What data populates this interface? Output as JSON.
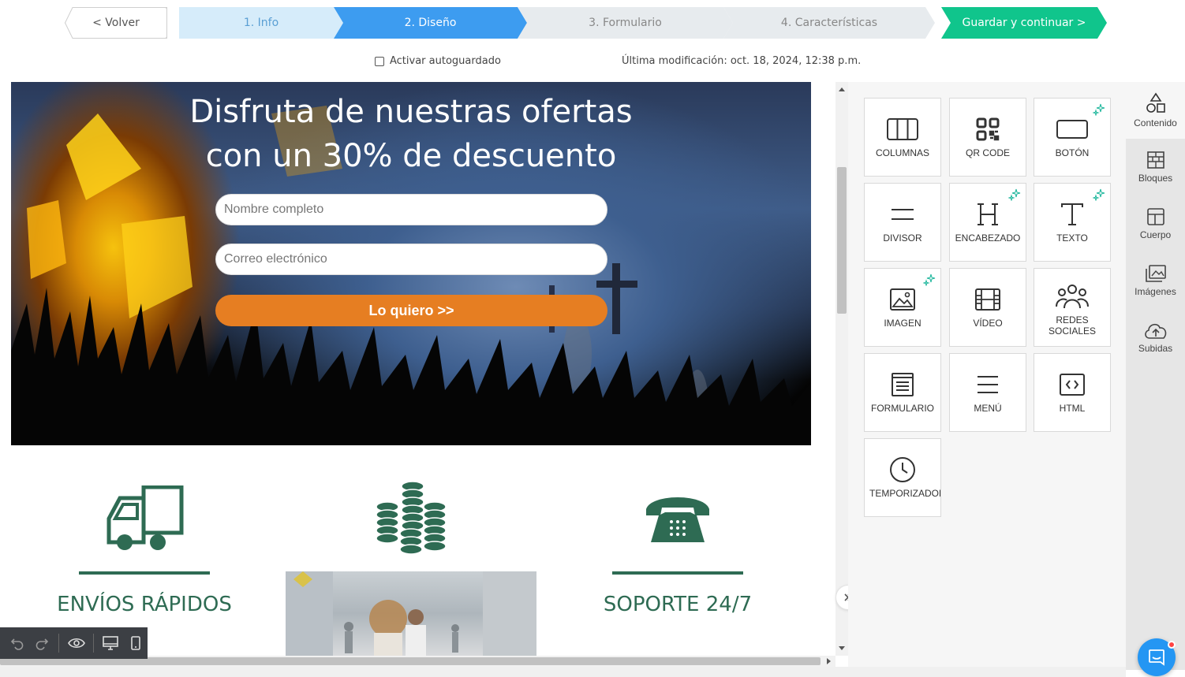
{
  "steps": {
    "back": "< Volver",
    "info": "1. Info",
    "design": "2. Diseño",
    "form": "3. Formulario",
    "features": "4. Características",
    "save": "Guardar y continuar >"
  },
  "subheader": {
    "autosave_label": "Activar autoguardado",
    "last_modified": "Última modificación: oct. 18, 2024, 12:38 p.m."
  },
  "hero": {
    "title_line1": "Disfruta de nuestras ofertas",
    "title_line2": "con un 30% de descuento",
    "name_placeholder": "Nombre completo",
    "email_placeholder": "Correo electrónico",
    "cta_label": "Lo quiero >>"
  },
  "features": {
    "shipping": "ENVÍOS RÁPIDOS",
    "support": "SOPORTE 24/7"
  },
  "colors": {
    "step_active": "#3d9cf0",
    "save_green": "#10c58c",
    "cta_orange": "#e67e22",
    "feature_green": "#2e6b53"
  },
  "panel": {
    "tiles": [
      {
        "label": "COLUMNAS",
        "icon": "columns-icon"
      },
      {
        "label": "QR CODE",
        "icon": "qr-code-icon"
      },
      {
        "label": "BOTÓN",
        "icon": "button-icon"
      },
      {
        "label": "DIVISOR",
        "icon": "divider-icon"
      },
      {
        "label": "ENCABEZADO",
        "icon": "heading-icon"
      },
      {
        "label": "TEXTO",
        "icon": "text-icon"
      },
      {
        "label": "IMAGEN",
        "icon": "image-icon"
      },
      {
        "label": "VÍDEO",
        "icon": "video-icon"
      },
      {
        "label": "REDES SOCIALES",
        "icon": "social-icon"
      },
      {
        "label": "FORMULARIO",
        "icon": "form-icon"
      },
      {
        "label": "MENÚ",
        "icon": "menu-icon"
      },
      {
        "label": "HTML",
        "icon": "html-icon"
      },
      {
        "label": "TEMPORIZADOR",
        "icon": "timer-icon"
      }
    ]
  },
  "rail": {
    "content": "Contenido",
    "blocks": "Bloques",
    "body": "Cuerpo",
    "images": "Imágenes",
    "uploads": "Subidas"
  }
}
